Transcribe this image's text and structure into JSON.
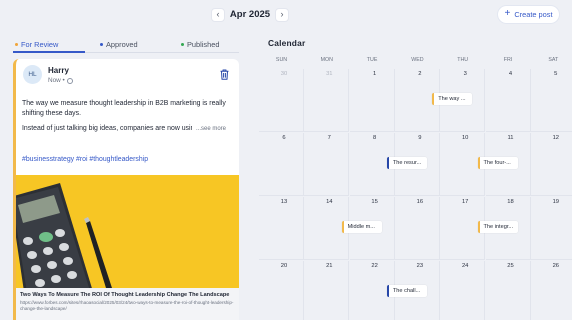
{
  "header": {
    "prev_icon": "chevron-left-icon",
    "next_icon": "chevron-right-icon",
    "prev_glyph": "‹",
    "next_glyph": "›",
    "month": "Apr 2025",
    "create_plus": "+",
    "create_label": "Create post"
  },
  "tabs": [
    {
      "label": "For Review",
      "color": "#f0a43a",
      "active": true
    },
    {
      "label": "Approved",
      "color": "#3659c8",
      "active": false
    },
    {
      "label": "Published",
      "color": "#34a853",
      "active": false
    }
  ],
  "post": {
    "avatar_initials": "HL",
    "author": "Harry",
    "time": "Now •",
    "text_line1": "The way we measure thought leadership in B2B marketing is really shifting these days.",
    "text_line2": "Instead of just talking big ideas, companies are now using finar",
    "see_more": "...see more",
    "hashtags": "#businesstrategy #roi #thoughtleadership",
    "link_title": "Two Ways To Measure The ROI Of Thought Leadership Change The Landscape",
    "link_url": "https://www.forbes.com/sites/rhaoasocial/2025/03/24/two-ways-to-measure-the-roi-of-thought-leadership-change-the-landscape/",
    "accent_color": "#f2b94a"
  },
  "calendar": {
    "title": "Calendar",
    "weekdays": [
      "SUN",
      "MON",
      "TUE",
      "WED",
      "THU",
      "FRI",
      "SAT"
    ],
    "weeks": [
      [
        "30",
        "31",
        "1",
        "2",
        "3",
        "4",
        "5"
      ],
      [
        "6",
        "7",
        "8",
        "9",
        "10",
        "11",
        "12"
      ],
      [
        "13",
        "14",
        "15",
        "16",
        "17",
        "18",
        "19"
      ],
      [
        "20",
        "21",
        "22",
        "23",
        "24",
        "25",
        "26"
      ]
    ],
    "events": [
      {
        "label": "The way ...",
        "week": 0,
        "day": 4,
        "color": "yellow"
      },
      {
        "label": "The resur...",
        "week": 1,
        "day": 3,
        "color": "blue"
      },
      {
        "label": "The four-...",
        "week": 1,
        "day": 5,
        "color": "yellow"
      },
      {
        "label": "Middle m...",
        "week": 2,
        "day": 2,
        "color": "yellow"
      },
      {
        "label": "The integr...",
        "week": 2,
        "day": 5,
        "color": "yellow"
      },
      {
        "label": "The chall...",
        "week": 3,
        "day": 3,
        "color": "blue"
      }
    ]
  }
}
